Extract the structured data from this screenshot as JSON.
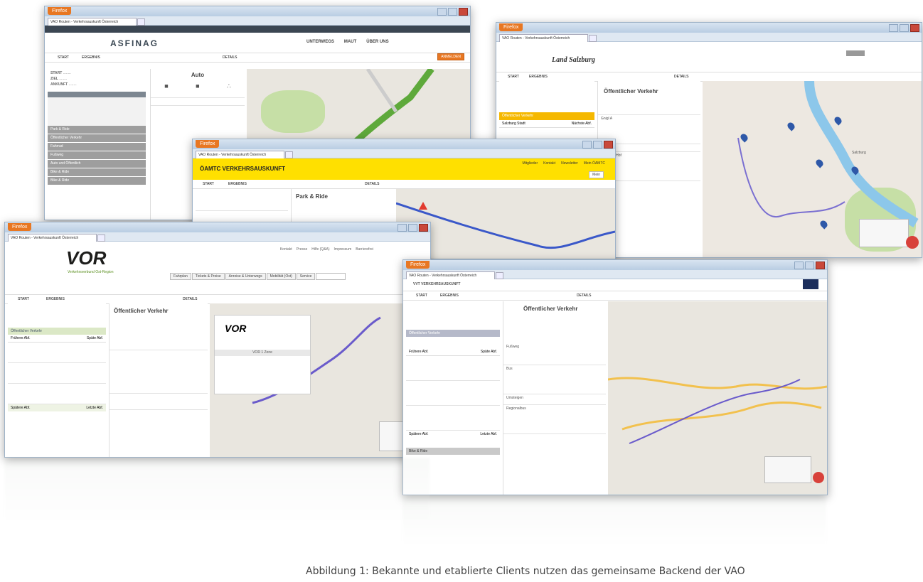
{
  "browser": {
    "button_label": "Firefox",
    "tab_label": "VAO Routen - Verkehrsauskunft Österreich"
  },
  "asfinag": {
    "logo": "ASFINAG",
    "nav": [
      "UNTERWEGS",
      "MAUT",
      "ÜBER UNS"
    ],
    "form_tabs": [
      "START",
      "ERGEBNIS"
    ],
    "details_label": "DETAILS",
    "section_title": "Auto",
    "sidebar_items": [
      "Park & Ride",
      "Öffentlicher Verkehr",
      "Fahrrad",
      "Fußweg",
      "Auto und Öffentlich",
      "Bike & Ride",
      "Bike & Ride"
    ],
    "orange_button": "ANMELDEN",
    "start_label": "START",
    "ziel_label": "ZIEL",
    "ankunft_label": "ANKUNFT"
  },
  "salzburg": {
    "logo": "Land Salzburg",
    "form_tabs": [
      "START",
      "ERGEBNIS"
    ],
    "details_label": "DETAILS",
    "section_title": "Öffentlicher Verkehr",
    "highlight_row": "Öffentlicher Verkehr",
    "list_header_left": "Salzburg Stadt",
    "list_header_right": "Nächste Abf.",
    "stop_items": [
      "Gnigl A",
      "Salzburg Hbf"
    ],
    "warning_label": "Warnung",
    "map_label": "Salzburg"
  },
  "oeamtc": {
    "logo": "ÖAMTC VERKEHRSAUSKUNFT",
    "nav": [
      "Mitglieder",
      "Kontakt",
      "Newsletter",
      "Mein ÖAMTC"
    ],
    "main_button": "Mein",
    "form_tabs": [
      "START",
      "ERGEBNIS"
    ],
    "details_label": "DETAILS",
    "section_title": "Park & Ride"
  },
  "vor": {
    "logo": "VOR",
    "logo_sub": "Verkehrsverbund Ost-Region",
    "nav": [
      "Fahrplan",
      "Tickets & Preise",
      "Anreise & Unterwegs",
      "Mobilität (Ost)",
      "Service"
    ],
    "top_links": [
      "Kontakt",
      "Presse",
      "Hilfe (Q&A)",
      "Impressum",
      "Barrierefrei"
    ],
    "form_tabs": [
      "START",
      "ERGEBNIS"
    ],
    "details_label": "DETAILS",
    "section_title": "Öffentlicher Verkehr",
    "list_header": "Öffentlicher Verkehr",
    "col_left": "Frühere Abf.",
    "col_right": "Späte Abf.",
    "bottom_left": "Spätere Abf.",
    "bottom_right": "Letzte Abf.",
    "route_header": "VOR 1 Zone",
    "popup_logo": "VOR"
  },
  "vvt": {
    "logo": "VVT VERKEHRSAUSKUNFT",
    "form_tabs": [
      "START",
      "ERGEBNIS"
    ],
    "details_label": "DETAILS",
    "section_title": "Öffentlicher Verkehr",
    "list_header": "Öffentlicher Verkehr",
    "col_left": "Frühere Abf.",
    "col_right": "Späte Abf.",
    "steps": [
      "Fußweg",
      "Bus",
      "Umsteigen",
      "Regionalbus"
    ],
    "bottom_left": "Spätere Abf.",
    "bottom_right": "Letzte Abf.",
    "bottom_item": "Bike & Ride"
  },
  "caption": "Abbildung 1: Bekannte und etablierte Clients nutzen das gemeinsame Backend der VAO"
}
